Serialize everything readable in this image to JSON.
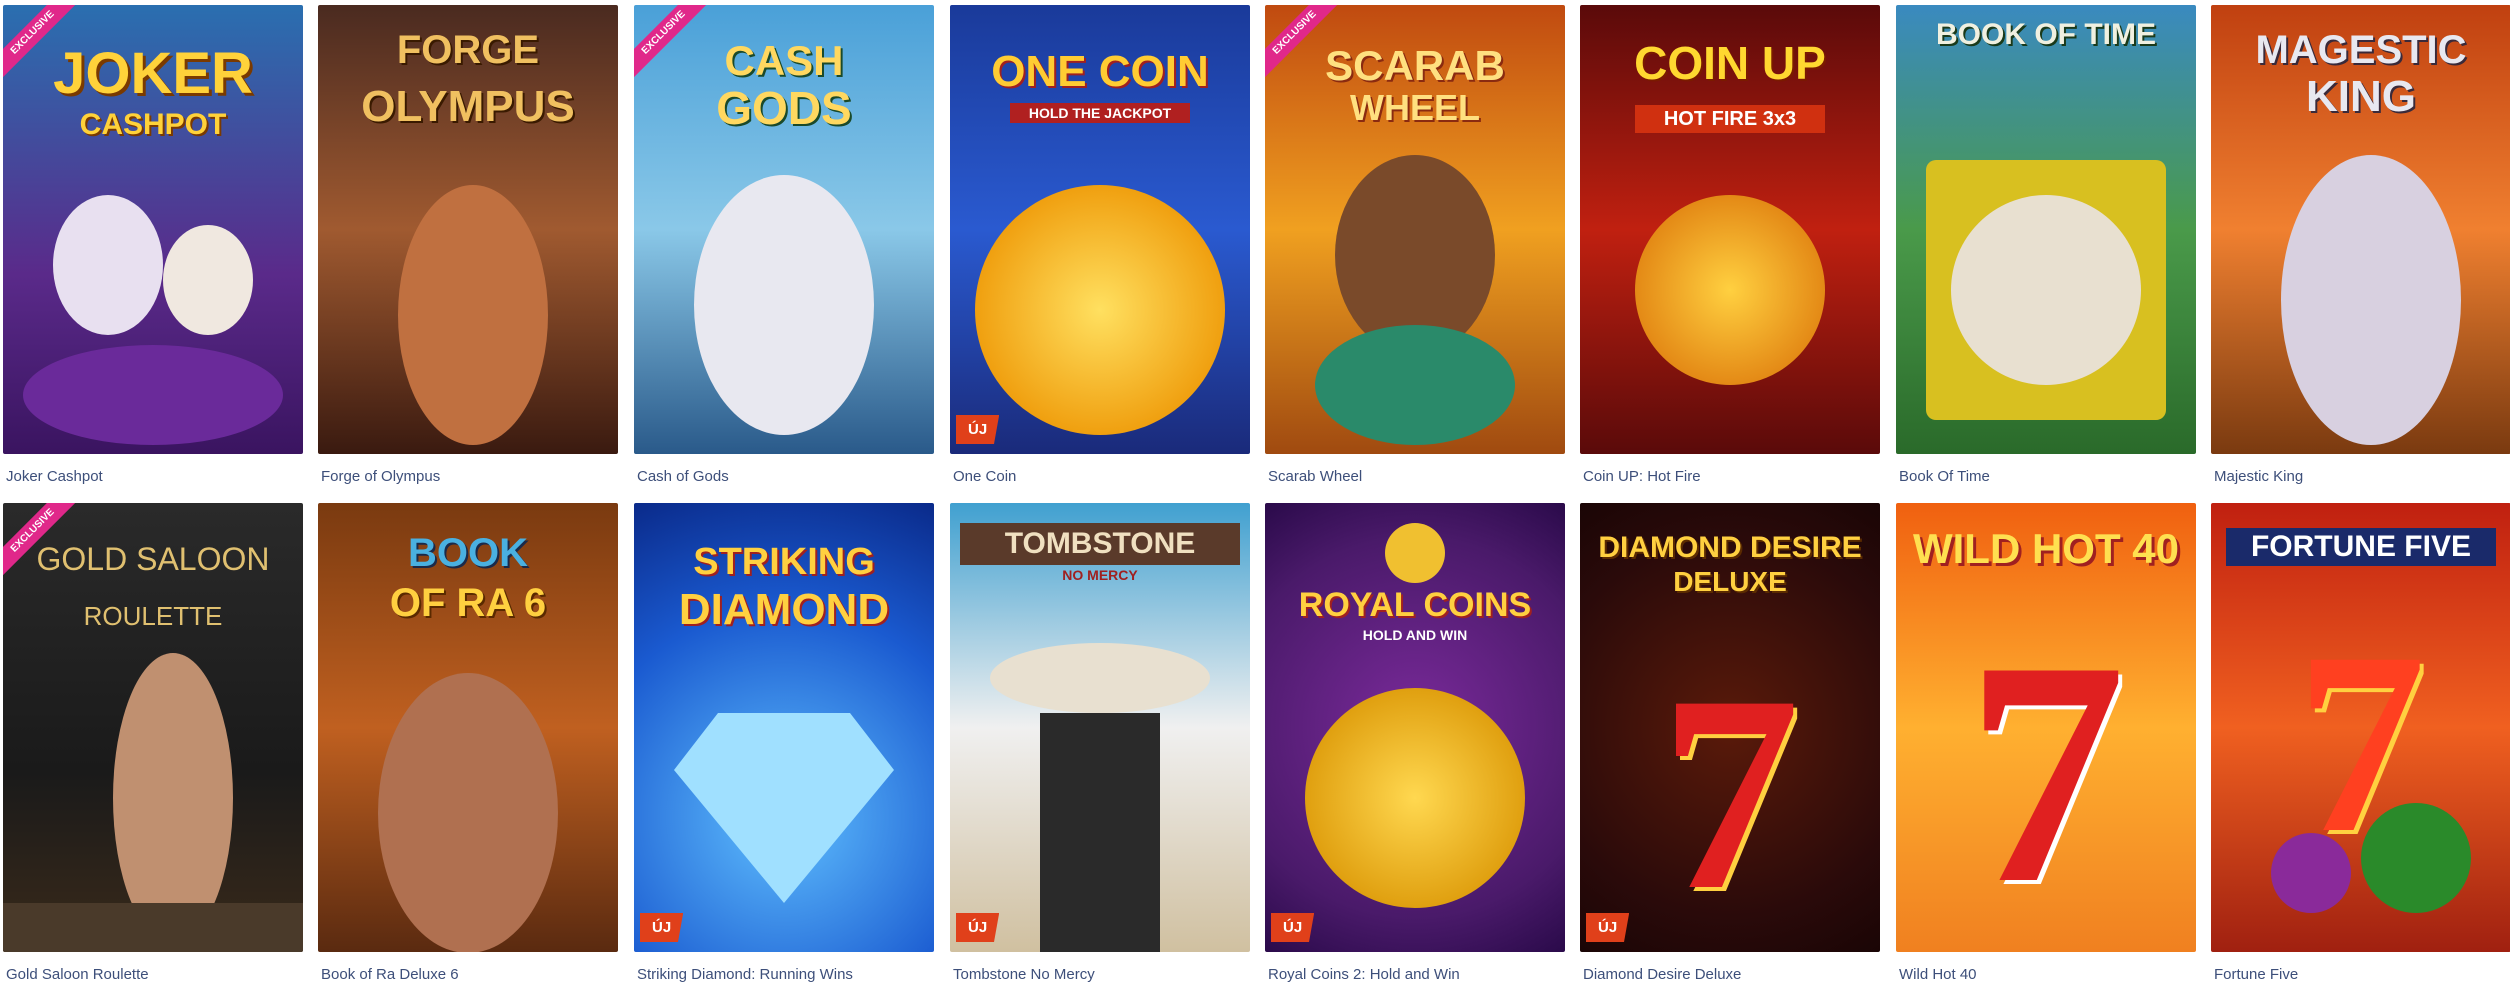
{
  "labels": {
    "exclusive": "EXCLUSIVE",
    "new": "ÚJ"
  },
  "games": [
    {
      "title": "Joker Cashpot",
      "logo": "JOKER",
      "logo2": "CASHPOT"
    },
    {
      "title": "Forge of Olympus",
      "logo": "FORGE",
      "logo2": "OLYMPUS"
    },
    {
      "title": "Cash of Gods",
      "logo": "CASH",
      "logo2": "GODS"
    },
    {
      "title": "One Coin",
      "logo": "ONE COIN",
      "logo2": "HOLD THE JACKPOT"
    },
    {
      "title": "Scarab Wheel",
      "logo": "SCARAB",
      "logo2": "WHEEL"
    },
    {
      "title": "Coin UP: Hot Fire",
      "logo": "COIN UP",
      "logo2": "HOT FIRE 3x3"
    },
    {
      "title": "Book Of Time",
      "logo": "BOOK OF TIME",
      "logo2": ""
    },
    {
      "title": "Majestic King",
      "logo": "MAGESTIC",
      "logo2": "KING"
    },
    {
      "title": "Gold Saloon Roulette",
      "logo": "GOLD SALOON",
      "logo2": "ROULETTE"
    },
    {
      "title": "Book of Ra Deluxe 6",
      "logo": "BOOK",
      "logo2": "OF RA 6"
    },
    {
      "title": "Striking Diamond: Running Wins",
      "logo": "STRIKING",
      "logo2": "DIAMOND"
    },
    {
      "title": "Tombstone No Mercy",
      "logo": "TOMBSTONE",
      "logo2": "NO MERCY"
    },
    {
      "title": "Royal Coins 2: Hold and Win",
      "logo": "ROYAL COINS",
      "logo2": "HOLD AND WIN"
    },
    {
      "title": "Diamond Desire Deluxe",
      "logo": "DIAMOND DESIRE",
      "logo2": "DELUXE"
    },
    {
      "title": "Wild Hot 40",
      "logo": "WILD HOT 40",
      "logo2": ""
    },
    {
      "title": "Fortune Five",
      "logo": "FORTUNE FIVE",
      "logo2": ""
    }
  ]
}
